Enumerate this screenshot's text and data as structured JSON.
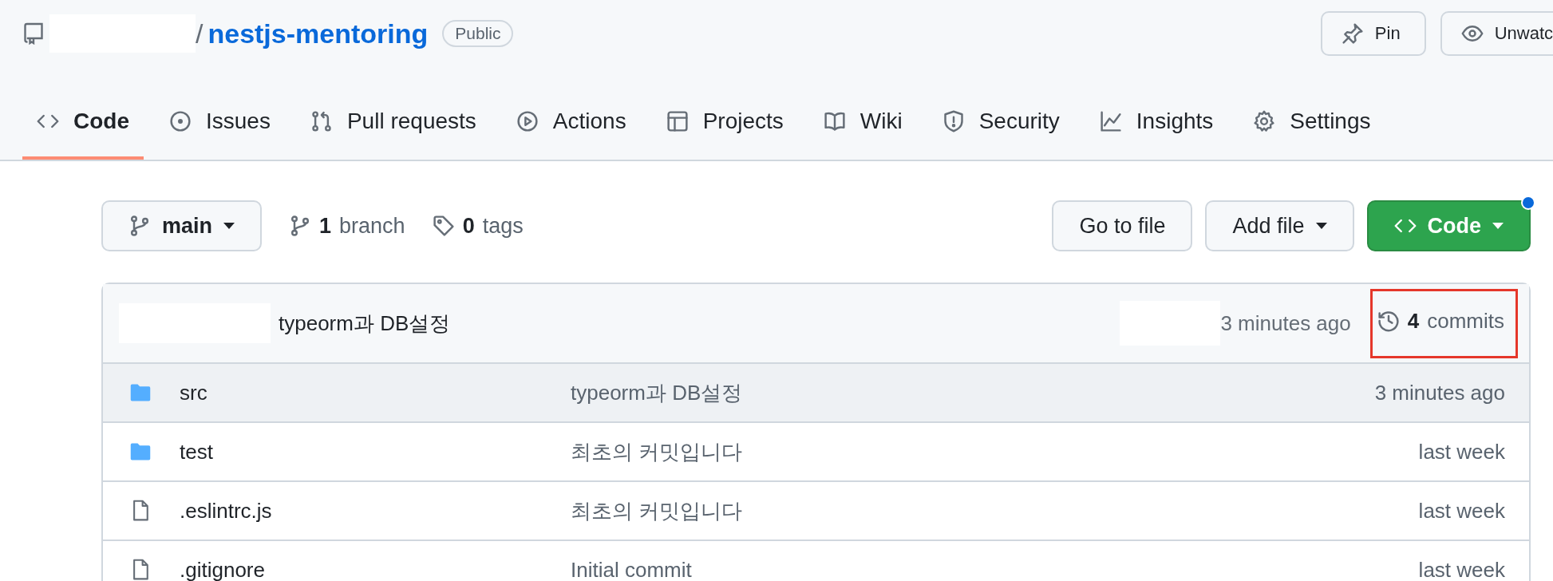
{
  "repo": {
    "separator": "/",
    "name": "nestjs-mentoring",
    "visibility": "Public"
  },
  "header_buttons": [
    {
      "kind": "pin",
      "label": "Pin"
    },
    {
      "kind": "watch",
      "label": "Unwatc"
    }
  ],
  "tabs": [
    {
      "kind": "code",
      "label": "Code",
      "selected": true
    },
    {
      "kind": "issues",
      "label": "Issues",
      "selected": false
    },
    {
      "kind": "pulls",
      "label": "Pull requests",
      "selected": false
    },
    {
      "kind": "actions",
      "label": "Actions",
      "selected": false
    },
    {
      "kind": "projects",
      "label": "Projects",
      "selected": false
    },
    {
      "kind": "wiki",
      "label": "Wiki",
      "selected": false
    },
    {
      "kind": "security",
      "label": "Security",
      "selected": false
    },
    {
      "kind": "insights",
      "label": "Insights",
      "selected": false
    },
    {
      "kind": "settings",
      "label": "Settings",
      "selected": false
    }
  ],
  "branch_selector": {
    "label": "main"
  },
  "counts": [
    {
      "kind": "branch",
      "count": "1",
      "label": "branch"
    },
    {
      "kind": "tag",
      "count": "0",
      "label": "tags"
    }
  ],
  "actions": [
    {
      "kind": "plain",
      "label": "Go to file"
    },
    {
      "kind": "dropdown",
      "label": "Add file"
    },
    {
      "kind": "primary",
      "label": "Code",
      "notification": true
    }
  ],
  "latest_commit": {
    "message": "typeorm과 DB설정",
    "time": "3 minutes ago",
    "commits_count": "4",
    "commits_label": "commits",
    "highlighted": true
  },
  "files": [
    {
      "kind": "folder",
      "name": "src",
      "message": "typeorm과 DB설정",
      "time": "3 minutes ago",
      "hovered": true
    },
    {
      "kind": "folder",
      "name": "test",
      "message": "최초의 커밋입니다",
      "time": "last week",
      "hovered": false
    },
    {
      "kind": "file",
      "name": ".eslintrc.js",
      "message": "최초의 커밋입니다",
      "time": "last week",
      "hovered": false
    },
    {
      "kind": "file",
      "name": ".gitignore",
      "message": "Initial commit",
      "time": "last week",
      "hovered": false
    }
  ]
}
